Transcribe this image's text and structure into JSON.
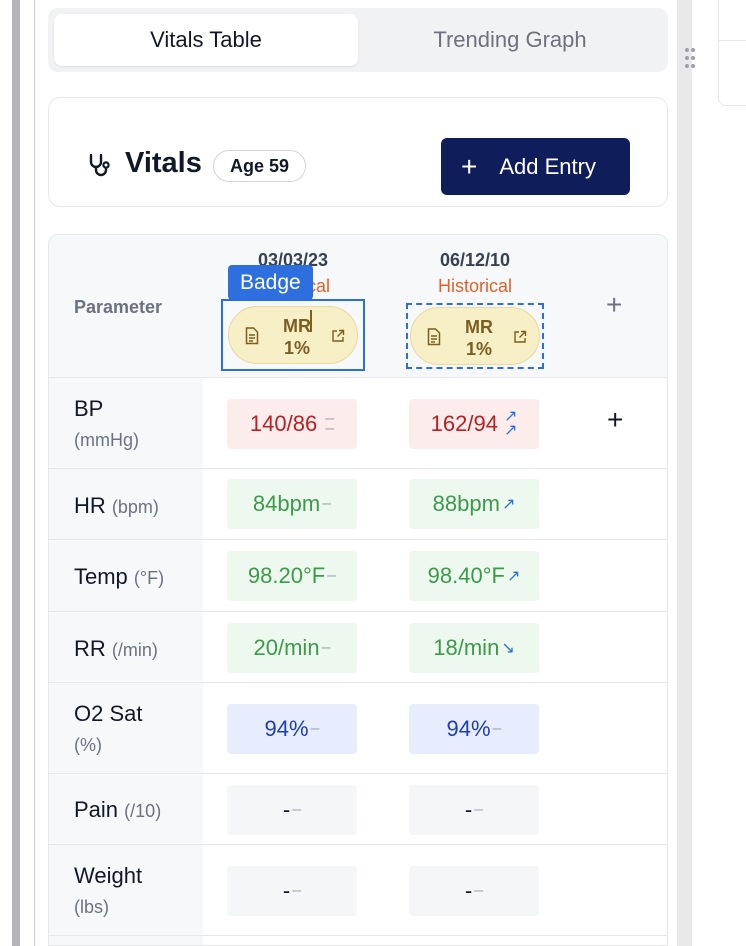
{
  "tabs": [
    {
      "label": "Vitals Table",
      "active": true
    },
    {
      "label": "Trending Graph",
      "active": false
    }
  ],
  "vitals": {
    "title": "Vitals",
    "age_badge": "Age 59",
    "add_entry_label": "Add Entry",
    "add_entry_icon": "+"
  },
  "table": {
    "parameter_header": "Parameter",
    "columns": [
      {
        "date": "03/03/23",
        "subtitle": "Historical",
        "badge_line1": "MR",
        "badge_line2": "1%"
      },
      {
        "date": "06/12/10",
        "subtitle": "Historical",
        "badge_line1": "MR",
        "badge_line2": "1%"
      }
    ],
    "add_column_icon": "+",
    "tooltip": "Badge",
    "rows": [
      {
        "name": "BP",
        "unit": "(mmHg)",
        "values": [
          {
            "text": "140/86",
            "trend": "–\n–"
          },
          {
            "text": "162/94",
            "trend": "↗↗"
          }
        ],
        "add_icon": "+"
      },
      {
        "name": "HR",
        "unit": "(bpm)",
        "values": [
          {
            "text": "84bpm",
            "trend": "–"
          },
          {
            "text": "88bpm",
            "trend": "↗"
          }
        ]
      },
      {
        "name": "Temp",
        "unit": "(°F)",
        "values": [
          {
            "text": "98.20°F",
            "trend": "–"
          },
          {
            "text": "98.40°F",
            "trend": "↗"
          }
        ]
      },
      {
        "name": "RR",
        "unit": "(/min)",
        "values": [
          {
            "text": "20/min",
            "trend": "–"
          },
          {
            "text": "18/min",
            "trend": "↘"
          }
        ]
      },
      {
        "name": "O2 Sat",
        "unit": "(%)",
        "values": [
          {
            "text": "94%",
            "trend": "–"
          },
          {
            "text": "94%",
            "trend": "–"
          }
        ]
      },
      {
        "name": "Pain",
        "unit": "(/10)",
        "values": [
          {
            "text": "-",
            "trend": "–"
          },
          {
            "text": "-",
            "trend": "–"
          }
        ]
      },
      {
        "name": "Weight",
        "unit": "(lbs)",
        "values": [
          {
            "text": "-",
            "trend": "–"
          },
          {
            "text": "-",
            "trend": "–"
          }
        ]
      }
    ]
  },
  "colors": {
    "primary": "#0f1e5a",
    "historical": "#e0622a",
    "abnormal_text": "#b42323",
    "normal_text": "#3d9a4a",
    "info_text": "#1e3fae",
    "focus_outline": "#2a6fdb"
  }
}
